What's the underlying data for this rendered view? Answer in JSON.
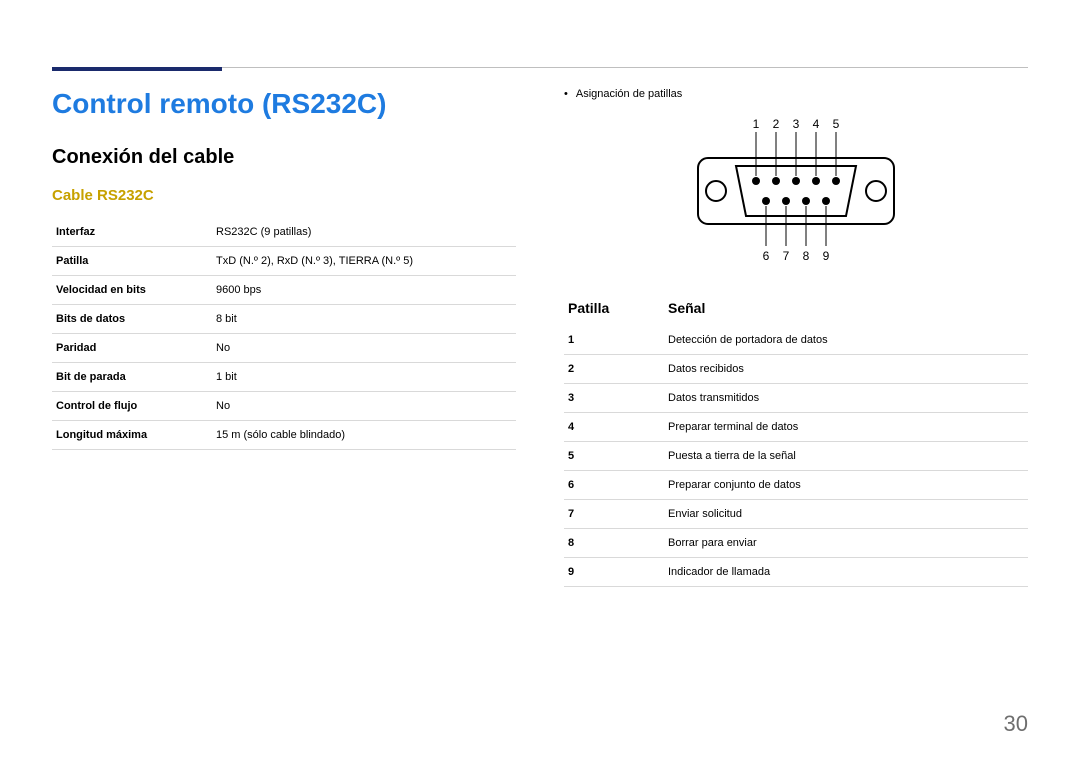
{
  "page_number": "30",
  "title": "Control remoto (RS232C)",
  "section": "Conexión del cable",
  "subsection": "Cable RS232C",
  "spec_table": {
    "rows": [
      {
        "label": "Interfaz",
        "value": "RS232C (9 patillas)"
      },
      {
        "label": "Patilla",
        "value": "TxD (N.º 2), RxD (N.º 3), TIERRA (N.º 5)"
      },
      {
        "label": "Velocidad en bits",
        "value": "9600 bps"
      },
      {
        "label": "Bits de datos",
        "value": "8 bit"
      },
      {
        "label": "Paridad",
        "value": "No"
      },
      {
        "label": "Bit de parada",
        "value": "1 bit"
      },
      {
        "label": "Control de flujo",
        "value": "No"
      },
      {
        "label": "Longitud máxima",
        "value": "15 m (sólo cable blindado)"
      }
    ]
  },
  "bullet": "Asignación de patillas",
  "connector": {
    "top_labels": [
      "1",
      "2",
      "3",
      "4",
      "5"
    ],
    "bottom_labels": [
      "6",
      "7",
      "8",
      "9"
    ]
  },
  "pin_table": {
    "head": {
      "col1": "Patilla",
      "col2": "Señal"
    },
    "rows": [
      {
        "num": "1",
        "signal": "Detección de portadora de datos"
      },
      {
        "num": "2",
        "signal": "Datos recibidos"
      },
      {
        "num": "3",
        "signal": "Datos transmitidos"
      },
      {
        "num": "4",
        "signal": "Preparar terminal de datos"
      },
      {
        "num": "5",
        "signal": "Puesta a tierra de la señal"
      },
      {
        "num": "6",
        "signal": "Preparar conjunto de datos"
      },
      {
        "num": "7",
        "signal": "Enviar solicitud"
      },
      {
        "num": "8",
        "signal": "Borrar para enviar"
      },
      {
        "num": "9",
        "signal": "Indicador de llamada"
      }
    ]
  }
}
